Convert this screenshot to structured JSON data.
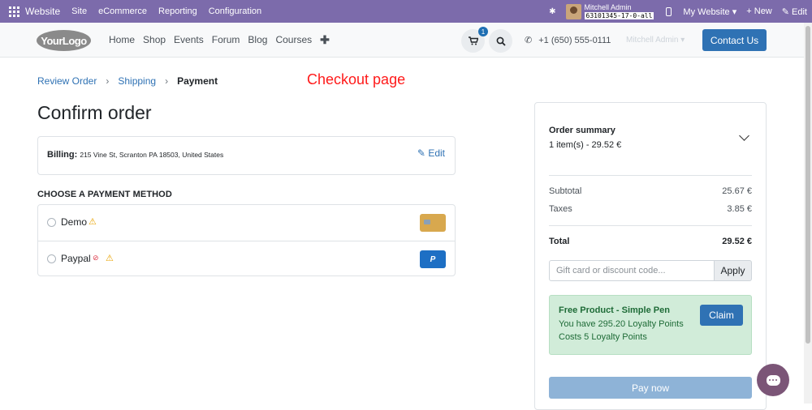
{
  "topbar": {
    "brand": "Website",
    "menu": [
      "Site",
      "eCommerce",
      "Reporting",
      "Configuration"
    ],
    "user_name": "Mitchell Admin",
    "db_name": "63101345-17-0-all",
    "my_website": "My Website ▾",
    "new": "+ New",
    "edit": "✎ Edit"
  },
  "nav": {
    "logo": "YourLogo",
    "links": [
      "Home",
      "Shop",
      "Events",
      "Forum",
      "Blog",
      "Courses"
    ],
    "plus": "✚",
    "cart_count": "1",
    "phone": "+1 (650) 555-0111",
    "user_dropdown": "Mitchell Admin ▾",
    "contact_us": "Contact Us"
  },
  "breadcrumb": {
    "review": "Review Order",
    "shipping": "Shipping",
    "payment": "Payment",
    "sep": "›"
  },
  "annotation": "Checkout page",
  "page_title": "Confirm order",
  "billing": {
    "label": "Billing:",
    "address": "215 Vine St, Scranton PA 18503, United States",
    "edit": "Edit"
  },
  "payment": {
    "title": "CHOOSE A PAYMENT METHOD",
    "methods": [
      {
        "name": "Demo"
      },
      {
        "name": "Paypal",
        "icon_text": "P"
      }
    ]
  },
  "summary": {
    "title": "Order summary",
    "items": "1 item(s) -  29.52 €",
    "subtotal_label": "Subtotal",
    "subtotal": "25.67 €",
    "taxes_label": "Taxes",
    "taxes": "3.85 €",
    "total_label": "Total",
    "total": "29.52 €",
    "coupon_placeholder": "Gift card or discount code...",
    "apply": "Apply",
    "loyalty": {
      "title": "Free Product - Simple Pen",
      "line1": "You have 295.20 Loyalty Points",
      "line2": "Costs 5 Loyalty Points",
      "claim": "Claim"
    },
    "pay_now": "Pay now"
  },
  "colors": {
    "topbar": "#7c6bab",
    "primary": "#2f72b4",
    "success_bg": "#d1ecd9",
    "annotation": "#ff1a1a"
  },
  "icons": [
    "apps-grid-icon",
    "bug-icon",
    "mobile-icon",
    "cart-icon",
    "search-icon",
    "phone-icon",
    "pencil-icon",
    "warning-icon",
    "eye-slash-icon",
    "credit-card-icon",
    "paypal-icon",
    "chevron-down-icon",
    "chat-icon"
  ]
}
